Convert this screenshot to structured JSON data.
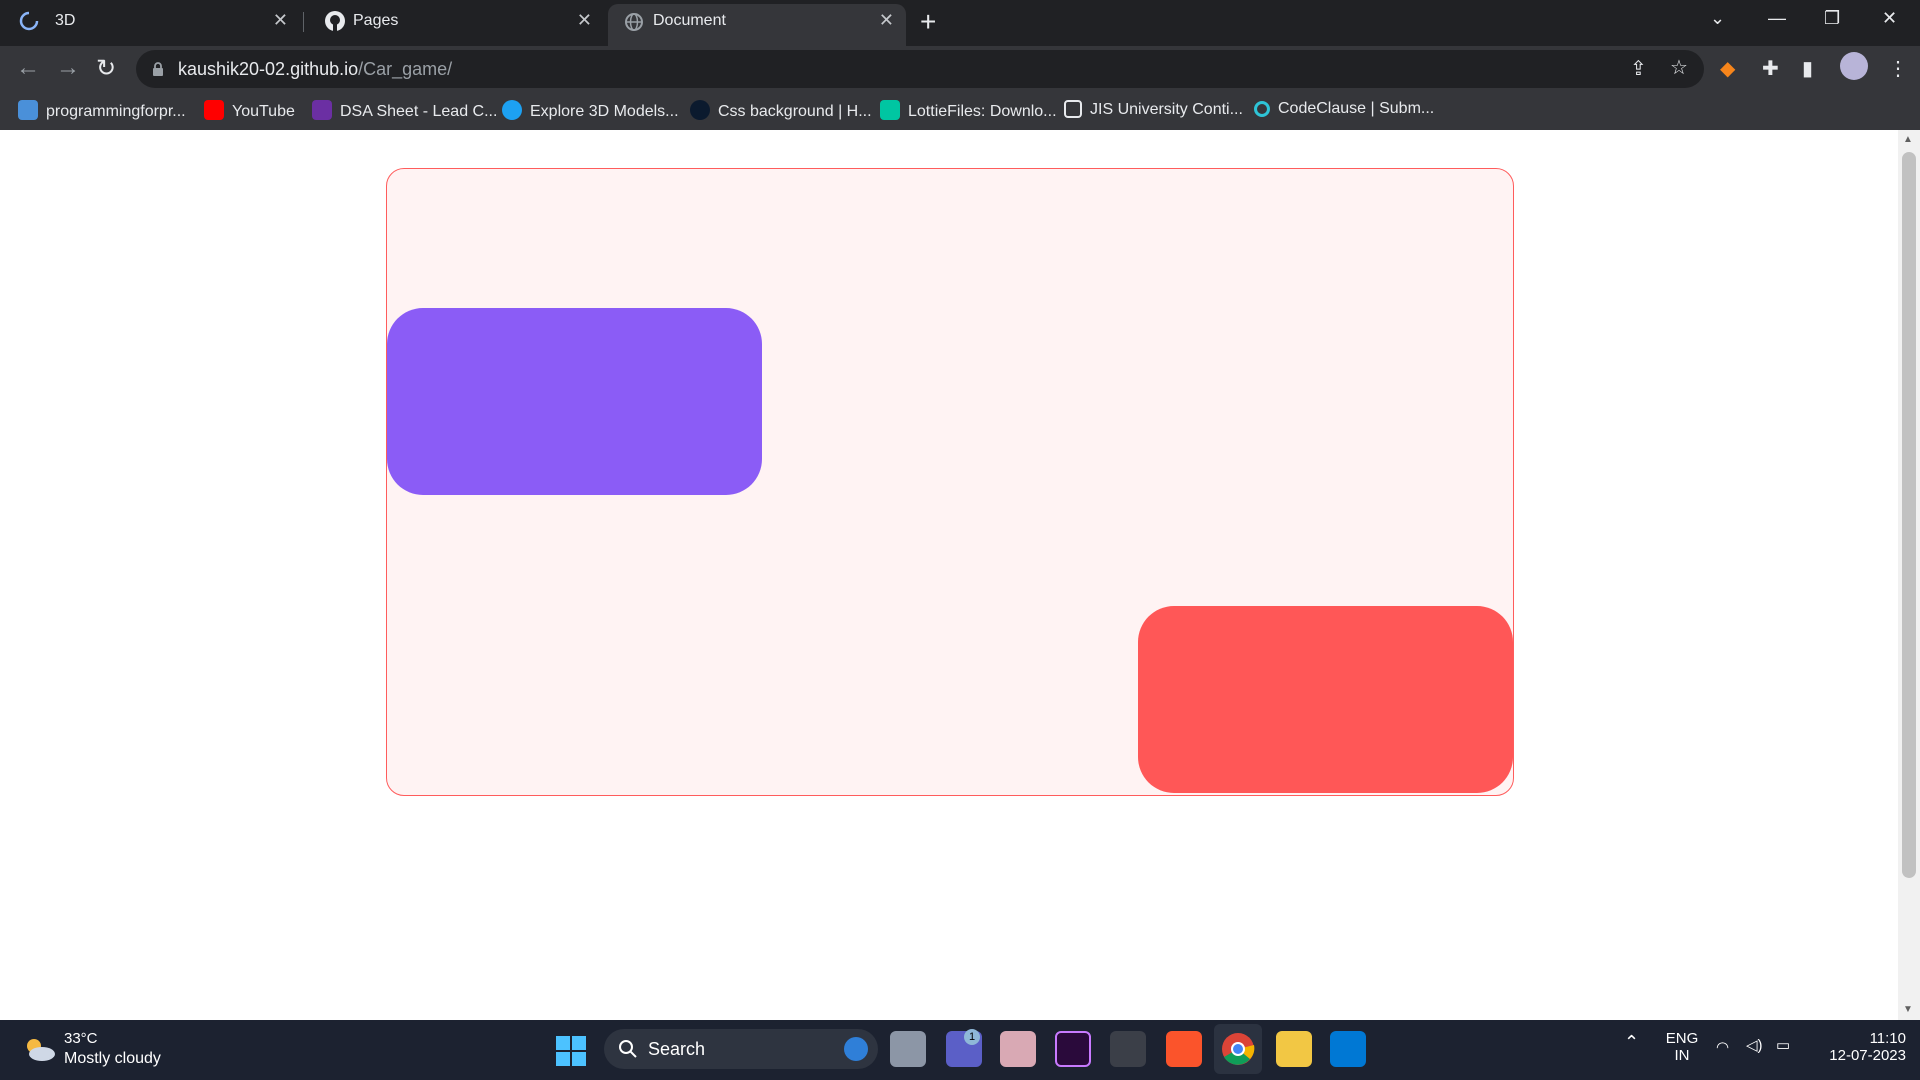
{
  "browser": {
    "tabs": [
      {
        "title": "3D",
        "icon": "loading-spinner-icon",
        "active": false
      },
      {
        "title": "Pages",
        "icon": "github-icon",
        "active": false
      },
      {
        "title": "Document",
        "icon": "globe-icon",
        "active": true
      }
    ],
    "new_tab_label": "+",
    "url_host": "kaushik20-02.github.io",
    "url_path": "/Car_game/",
    "bookmarks": [
      {
        "label": "programmingforpr...",
        "color": "#4a90d9"
      },
      {
        "label": "YouTube",
        "color": "#ff0000"
      },
      {
        "label": "DSA Sheet - Lead C...",
        "color": "#6b2fa3"
      },
      {
        "label": "Explore 3D Models...",
        "color": "#1da1f2"
      },
      {
        "label": "Css background | H...",
        "color": "#0b1a2e"
      },
      {
        "label": "LottieFiles: Downlo...",
        "color": "#00c6a2"
      },
      {
        "label": "JIS University Conti...",
        "color": "#e8eaed"
      },
      {
        "label": "CodeClause | Subm...",
        "color": "#2ec4d6"
      }
    ]
  },
  "game": {
    "border_color": "#ff5c5c",
    "background": "#fff3f3",
    "cars": [
      {
        "name": "player-car",
        "color": "#8b5cf6"
      },
      {
        "name": "enemy-car",
        "color": "#ff5757"
      }
    ]
  },
  "taskbar": {
    "weather_temp": "33°C",
    "weather_condition": "Mostly cloudy",
    "search_label": "Search",
    "language_top": "ENG",
    "language_bottom": "IN",
    "time": "11:10",
    "date": "12-07-2023",
    "notification_badge": "1"
  }
}
